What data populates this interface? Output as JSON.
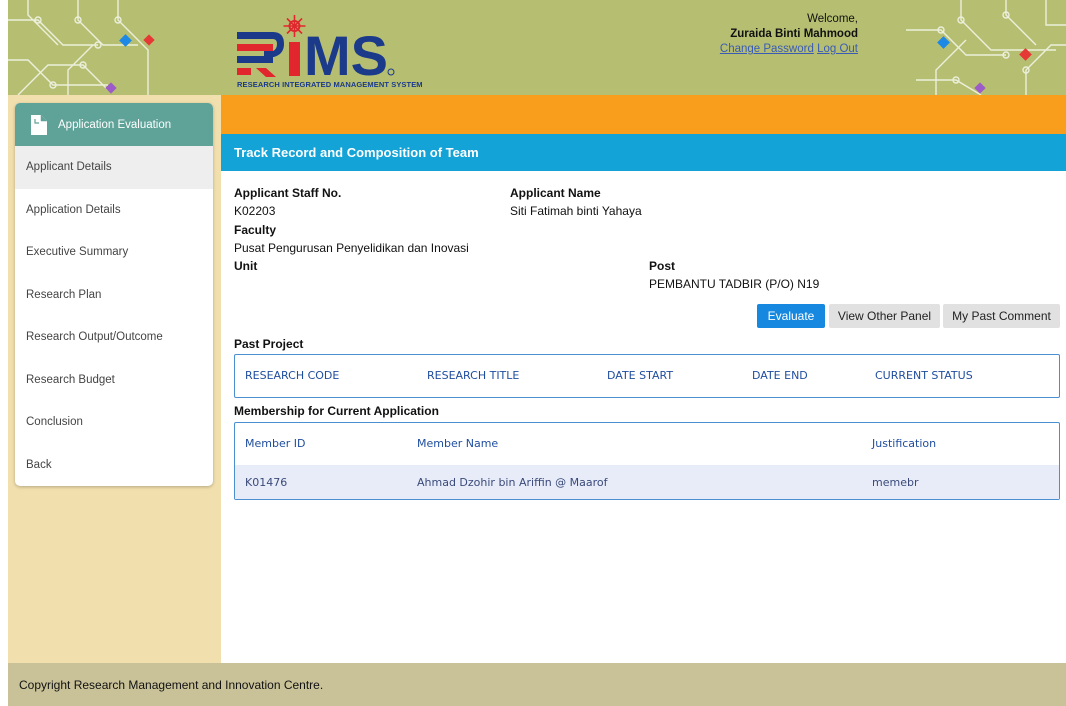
{
  "header": {
    "logo_text": "RiMS",
    "logo_subtitle": "RESEARCH INTEGRATED MANAGEMENT SYSTEM",
    "welcome": "Welcome,",
    "user_name": "Zuraida Binti Mahmood",
    "change_password": "Change Password",
    "log_out": "Log Out"
  },
  "sidebar": {
    "title": "Application Evaluation",
    "items": [
      {
        "label": "Applicant Details",
        "active": true
      },
      {
        "label": "Application Details"
      },
      {
        "label": "Executive Summary"
      },
      {
        "label": "Research Plan"
      },
      {
        "label": "Research Output/Outcome"
      },
      {
        "label": "Research Budget"
      },
      {
        "label": "Conclusion"
      },
      {
        "label": "Back"
      }
    ]
  },
  "main": {
    "section_title": "Track Record and Composition of Team",
    "staff_no_label": "Applicant Staff No.",
    "staff_no": "K02203",
    "name_label": "Applicant Name",
    "name": "Siti Fatimah binti Yahaya",
    "faculty_label": "Faculty",
    "faculty": "Pusat Pengurusan Penyelidikan dan Inovasi",
    "unit_label": "Unit",
    "post_label": "Post",
    "post": "PEMBANTU TADBIR (P/O) N19",
    "buttons": {
      "evaluate": "Evaluate",
      "view_other_panel": "View Other Panel",
      "my_past_comment": "My Past Comment"
    },
    "past_project": {
      "title": "Past Project",
      "columns": [
        "RESEARCH CODE",
        "RESEARCH TITLE",
        "DATE START",
        "DATE END",
        "CURRENT STATUS"
      ]
    },
    "membership": {
      "title": "Membership for Current Application",
      "columns": [
        "Member ID",
        "Member Name",
        "Justification"
      ],
      "rows": [
        [
          "K01476",
          "Ahmad Dzohir bin Ariffin @ Maarof",
          "memebr"
        ]
      ]
    }
  },
  "footer": {
    "copyright": "Copyright Research Management and Innovation Centre."
  },
  "colors": {
    "header_bg": "#b6bf71",
    "sidebar_bg": "#f1dfad",
    "sidebar_head": "#5ea298",
    "orange_bar": "#f99e1c",
    "blue_bar": "#14a3d7",
    "primary_button": "#1688e0",
    "footer_bg": "#c9c299"
  },
  "icons": [
    "circuit-pattern",
    "document-icon",
    "logo-star-icon"
  ]
}
